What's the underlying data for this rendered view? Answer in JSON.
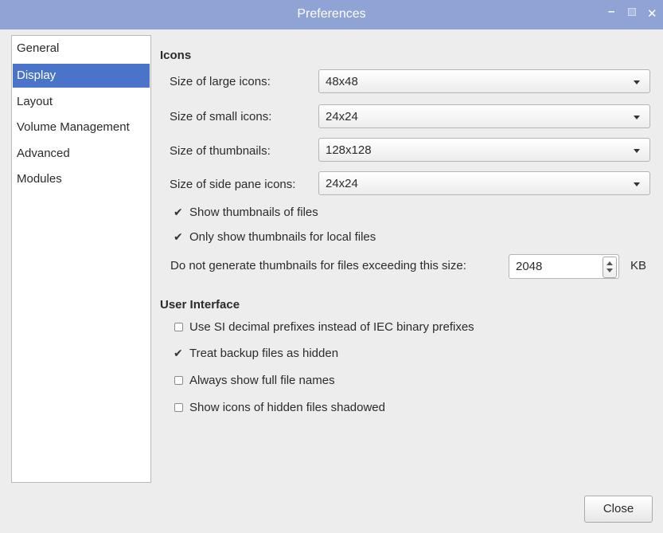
{
  "window": {
    "title": "Preferences",
    "min_glyph": "–",
    "close_glyph": "✕"
  },
  "sidebar": {
    "items": [
      {
        "label": "General",
        "selected": false
      },
      {
        "label": "Display",
        "selected": true
      },
      {
        "label": "Layout",
        "selected": false
      },
      {
        "label": "Volume Management",
        "selected": false
      },
      {
        "label": "Advanced",
        "selected": false
      },
      {
        "label": "Modules",
        "selected": false
      }
    ]
  },
  "icons_section": {
    "title": "Icons",
    "rows": [
      {
        "label": "Size of large icons:",
        "value": "48x48"
      },
      {
        "label": "Size of small icons:",
        "value": "24x24"
      },
      {
        "label": "Size of thumbnails:",
        "value": "128x128"
      },
      {
        "label": "Size of side pane icons:",
        "value": "24x24"
      }
    ],
    "checks": [
      {
        "label": "Show thumbnails of files",
        "checked": true
      },
      {
        "label": "Only show thumbnails for local files",
        "checked": true
      }
    ],
    "size_limit": {
      "label": "Do not generate thumbnails for files exceeding this size:",
      "value": "2048",
      "unit": "KB"
    }
  },
  "ui_section": {
    "title": "User Interface",
    "checks": [
      {
        "label": "Use SI decimal prefixes instead of IEC binary prefixes",
        "checked": false
      },
      {
        "label": "Treat backup files as hidden",
        "checked": true
      },
      {
        "label": "Always show full file names",
        "checked": false
      },
      {
        "label": "Show icons of hidden files shadowed",
        "checked": false
      }
    ]
  },
  "footer": {
    "close_label": "Close"
  },
  "colors": {
    "titlebar": "#8fa3d4",
    "selection": "#4a74c9"
  }
}
